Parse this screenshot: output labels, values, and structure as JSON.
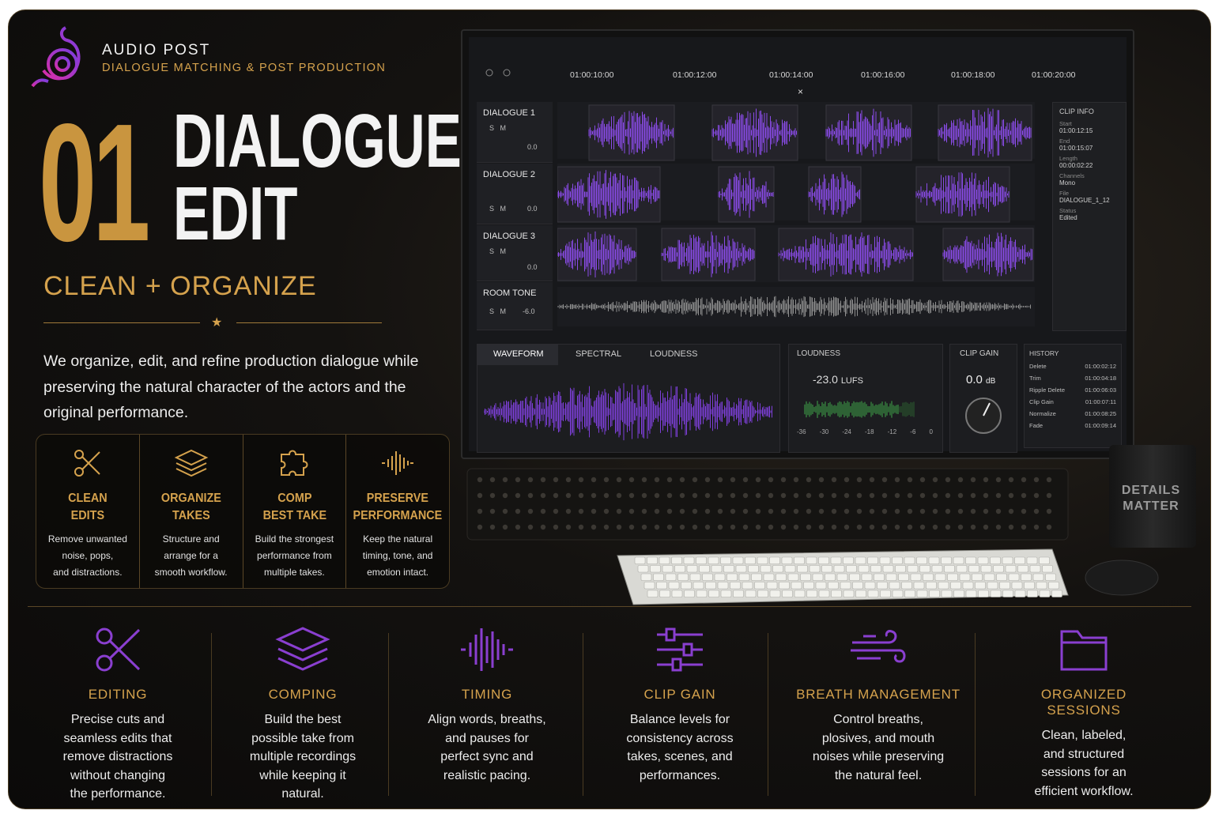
{
  "brand": {
    "title": "AUDIO POST",
    "subtitle": "DIALOGUE MATCHING & POST PRODUCTION"
  },
  "hero": {
    "number": "01",
    "title_line1": "DIALOGUE",
    "title_line2": "EDIT",
    "tagline": "CLEAN + ORGANIZE"
  },
  "intro": "We organize, edit, and refine production dialogue while preserving the natural character of the actors and the original performance.",
  "features": [
    {
      "icon": "scissors-icon",
      "title1": "CLEAN",
      "title2": "EDITS",
      "desc1": "Remove unwanted",
      "desc2": "noise, pops,",
      "desc3": "and distractions."
    },
    {
      "icon": "layers-icon",
      "title1": "ORGANIZE",
      "title2": "TAKES",
      "desc1": "Structure and",
      "desc2": "arrange for a",
      "desc3": "smooth workflow."
    },
    {
      "icon": "puzzle-icon",
      "title1": "COMP",
      "title2": "BEST TAKE",
      "desc1": "Build the strongest",
      "desc2": "performance from",
      "desc3": "multiple takes."
    },
    {
      "icon": "waveform-icon",
      "title1": "PRESERVE",
      "title2": "PERFORMANCE",
      "desc1": "Keep the natural",
      "desc2": "timing, tone, and",
      "desc3": "emotion intact."
    }
  ],
  "daw": {
    "timecodes": [
      "01:00:10:00",
      "01:00:12:00",
      "01:00:14:00",
      "01:00:16:00",
      "01:00:18:00",
      "01:00:20:00"
    ],
    "tracks": [
      {
        "name": "DIALOGUE 1",
        "s": "S",
        "m": "M",
        "vol": "0.0"
      },
      {
        "name": "DIALOGUE 2",
        "s": "S",
        "m": "M",
        "vol": "0.0"
      },
      {
        "name": "DIALOGUE 3",
        "s": "S",
        "m": "M",
        "vol": "0.0"
      },
      {
        "name": "ROOM TONE",
        "s": "S",
        "m": "M",
        "vol": "-6.0"
      }
    ],
    "clip_info": {
      "header": "CLIP INFO",
      "start_label": "Start",
      "start": "01:00:12:15",
      "end_label": "End",
      "end": "01:00:15:07",
      "length_label": "Length",
      "length": "00:00:02:22",
      "channels_label": "Channels",
      "channels": "Mono",
      "file_label": "File",
      "file": "DIALOGUE_1_12",
      "status_label": "Status",
      "status": "Edited"
    },
    "tabs": [
      "WAVEFORM",
      "SPECTRAL",
      "LOUDNESS"
    ],
    "loudness": {
      "header": "LOUDNESS",
      "value": "-23.0",
      "unit": "LUFS",
      "scale": [
        "-36",
        "-30",
        "-24",
        "-18",
        "-12",
        "-6",
        "0"
      ]
    },
    "clip_gain": {
      "header": "CLIP GAIN",
      "value": "0.0",
      "unit": "dB"
    },
    "history": {
      "header": "HISTORY",
      "rows": [
        {
          "action": "Delete",
          "time": "01:00:02:12"
        },
        {
          "action": "Trim",
          "time": "01:00:04:18"
        },
        {
          "action": "Ripple Delete",
          "time": "01:00:06:03"
        },
        {
          "action": "Clip Gain",
          "time": "01:00:07:11"
        },
        {
          "action": "Normalize",
          "time": "01:00:08:25"
        },
        {
          "action": "Fade",
          "time": "01:00:09:14"
        }
      ]
    }
  },
  "mug": {
    "line1": "DETAILS",
    "line2": "MATTER"
  },
  "services": [
    {
      "icon": "scissors-icon",
      "title": "EDITING",
      "lines": [
        "Precise cuts and",
        "seamless edits that",
        "remove distractions",
        "without changing",
        "the performance."
      ]
    },
    {
      "icon": "layers-icon",
      "title": "COMPING",
      "lines": [
        "Build the best",
        "possible take from",
        "multiple recordings",
        "while keeping it",
        "natural."
      ]
    },
    {
      "icon": "waveform-icon",
      "title": "TIMING",
      "lines": [
        "Align words, breaths,",
        "and pauses for",
        "perfect sync and",
        "realistic pacing."
      ]
    },
    {
      "icon": "sliders-icon",
      "title": "CLIP GAIN",
      "lines": [
        "Balance levels for",
        "consistency across",
        "takes, scenes, and",
        "performances."
      ]
    },
    {
      "icon": "wind-icon",
      "title": "BREATH MANAGEMENT",
      "lines": [
        "Control breaths,",
        "plosives, and mouth",
        "noises while preserving",
        "the natural feel."
      ]
    },
    {
      "icon": "folder-icon",
      "title": "ORGANIZED SESSIONS",
      "lines": [
        "Clean, labeled,",
        "and structured",
        "sessions for an",
        "efficient workflow."
      ]
    }
  ],
  "colors": {
    "gold": "#d5a24d",
    "purple": "#8a3fd0",
    "background": "#0f0d0b"
  }
}
